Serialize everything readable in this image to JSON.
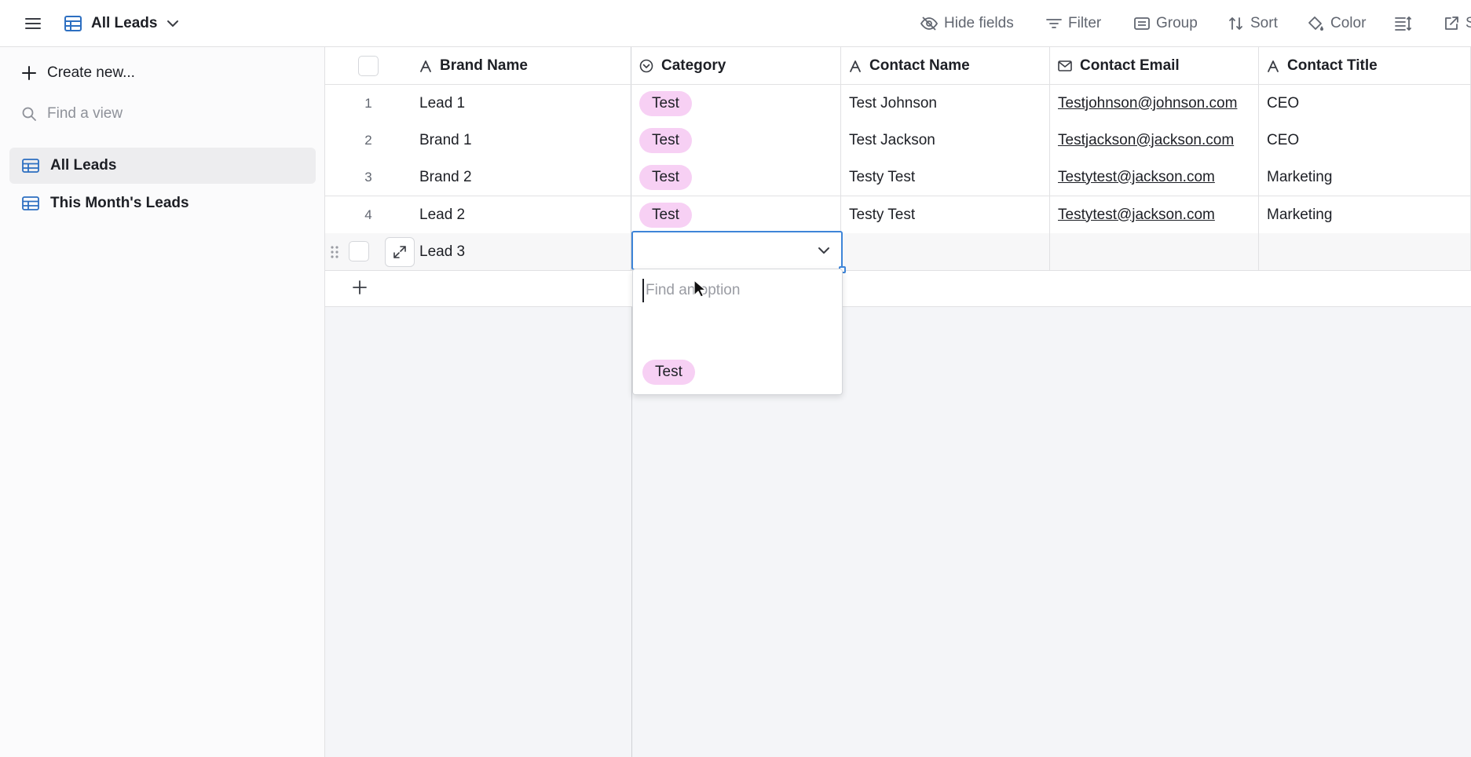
{
  "topbar": {
    "view_title": "All Leads",
    "tools": {
      "hide_fields": "Hide fields",
      "filter": "Filter",
      "group": "Group",
      "sort": "Sort",
      "color": "Color",
      "share_partial": "S"
    }
  },
  "sidebar": {
    "create_new": "Create new...",
    "find_placeholder": "Find a view",
    "views": [
      {
        "label": "All Leads"
      },
      {
        "label": "This Month's Leads"
      }
    ]
  },
  "table": {
    "columns": {
      "brand": "Brand Name",
      "category": "Category",
      "contact_name": "Contact Name",
      "contact_email": "Contact Email",
      "contact_title": "Contact Title"
    },
    "rows": [
      {
        "idx": "1",
        "brand": "Lead 1",
        "category": "Test",
        "contact_name": "Test Johnson",
        "contact_email": "Testjohnson@johnson.com",
        "contact_title": "CEO"
      },
      {
        "idx": "2",
        "brand": "Brand 1",
        "category": "Test",
        "contact_name": "Test Jackson",
        "contact_email": "Testjackson@jackson.com",
        "contact_title": "CEO"
      },
      {
        "idx": "3",
        "brand": "Brand 2",
        "category": "Test",
        "contact_name": "Testy Test",
        "contact_email": "Testytest@jackson.com",
        "contact_title": "Marketing"
      },
      {
        "idx": "4",
        "brand": "Lead 2",
        "category": "Test",
        "contact_name": "Testy Test",
        "contact_email": "Testytest@jackson.com",
        "contact_title": "Marketing"
      }
    ],
    "editing_row": {
      "brand": "Lead 3"
    }
  },
  "dropdown": {
    "search_placeholder": "Find an option",
    "options": [
      "Test"
    ]
  },
  "colors": {
    "accent_blue": "#3e85d8",
    "pill_pink": "#f7d0f4",
    "grid_bg": "#f4f5f8"
  }
}
